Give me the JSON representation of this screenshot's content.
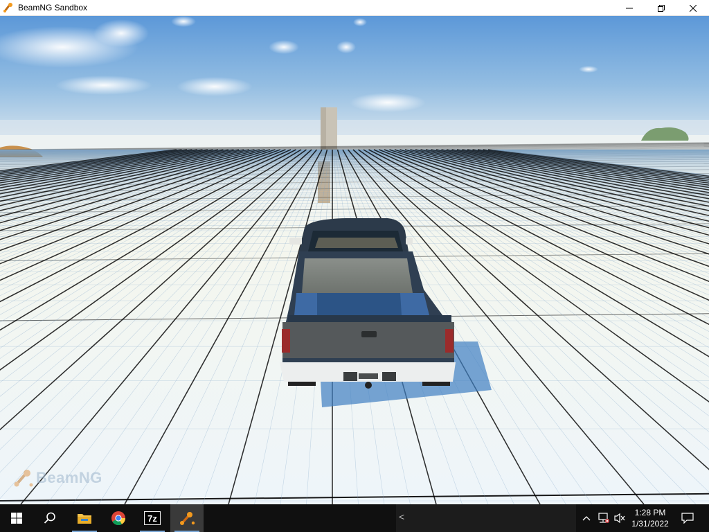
{
  "window": {
    "title": "BeamNG Sandbox",
    "minimize_icon": "minimize-icon",
    "restore_icon": "restore-icon",
    "close_icon": "close-icon"
  },
  "viewport": {
    "watermark_text": "BeamNG"
  },
  "taskbar": {
    "items": [
      {
        "name": "start-button",
        "icon": "windows-logo-icon"
      },
      {
        "name": "search-button",
        "icon": "search-icon"
      },
      {
        "name": "file-explorer-button",
        "icon": "folder-icon"
      },
      {
        "name": "chrome-button",
        "icon": "chrome-icon"
      },
      {
        "name": "7zip-button",
        "icon": "7zip-icon",
        "label": "7z"
      },
      {
        "name": "beamng-button",
        "icon": "beamng-icon",
        "active": true
      }
    ],
    "tray": {
      "chevron": "<",
      "clock_time": "1:28 PM",
      "clock_date": "1/31/2022"
    }
  },
  "colors": {
    "titlebar_bg": "#ffffff",
    "taskbar_bg": "#101010",
    "sky_top": "#5b97d9",
    "sky_horizon": "#cfe0ee",
    "ground": "#f3f6f3",
    "truck_body": "#2f3f52",
    "tailgate": "#55595b"
  }
}
